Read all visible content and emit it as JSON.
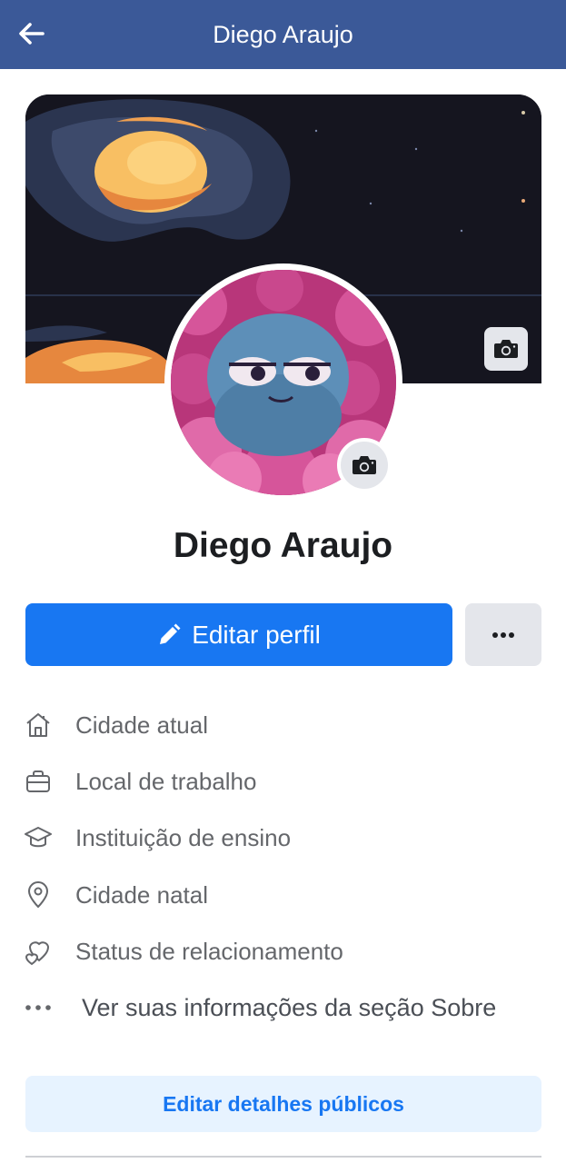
{
  "header": {
    "title": "Diego Araujo"
  },
  "profile": {
    "name": "Diego Araujo"
  },
  "actions": {
    "edit_profile_label": "Editar perfil"
  },
  "details": [
    {
      "icon": "home-icon",
      "label": "Cidade atual"
    },
    {
      "icon": "briefcase-icon",
      "label": "Local de trabalho"
    },
    {
      "icon": "graduation-cap-icon",
      "label": "Instituição de ensino"
    },
    {
      "icon": "location-pin-icon",
      "label": "Cidade natal"
    },
    {
      "icon": "heart-icon",
      "label": "Status de relacionamento"
    },
    {
      "icon": "more-dots-icon",
      "label": "Ver suas informações da seção Sobre"
    }
  ],
  "edit_details_label": "Editar detalhes públicos",
  "colors": {
    "topbar": "#3b5998",
    "primary": "#1877f2",
    "secondary_bg": "#e4e6eb",
    "light_blue_bg": "#e7f3ff",
    "muted_text": "#65676b"
  }
}
